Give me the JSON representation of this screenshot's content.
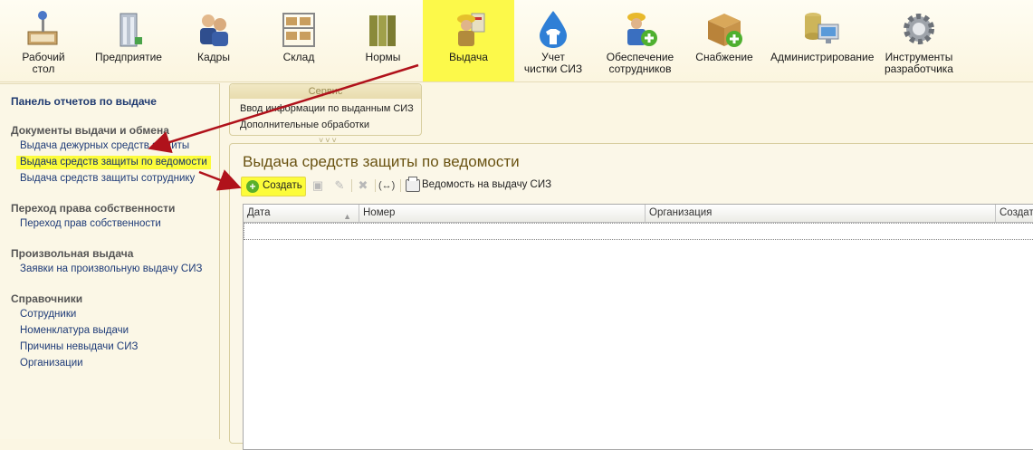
{
  "sections": [
    {
      "label": "Рабочий\nстол",
      "icon": "desk-icon"
    },
    {
      "label": "Предприятие",
      "icon": "building-icon"
    },
    {
      "label": "Кадры",
      "icon": "people-icon"
    },
    {
      "label": "Склад",
      "icon": "warehouse-shelves-icon"
    },
    {
      "label": "Нормы",
      "icon": "binders-icon"
    },
    {
      "label": "Выдача",
      "icon": "worker-issue-icon"
    },
    {
      "label": "Учет\nчистки СИЗ",
      "icon": "water-drop-shirt-icon"
    },
    {
      "label": "Обеспечение\nсотрудников",
      "icon": "worker-add-icon"
    },
    {
      "label": "Снабжение",
      "icon": "box-add-icon"
    },
    {
      "label": "Администрирование",
      "icon": "database-monitor-icon"
    },
    {
      "label": "Инструменты\nразработчика",
      "icon": "gear-icon"
    }
  ],
  "left_panel": {
    "title": "Панель отчетов по выдаче",
    "groups": [
      {
        "title": "Документы выдачи и обмена",
        "items": [
          "Выдача дежурных средств защиты",
          "Выдача средств защиты по ведомости",
          "Выдача средств защиты сотруднику"
        ]
      },
      {
        "title": "Переход права собственности",
        "items": [
          "Переход прав собственности"
        ]
      },
      {
        "title": "Произвольная выдача",
        "items": [
          "Заявки на произвольную выдачу СИЗ"
        ]
      },
      {
        "title": "Справочники",
        "items": [
          "Сотрудники",
          "Номенклатура выдачи",
          "Причины невыдачи СИЗ",
          "Организации"
        ]
      }
    ]
  },
  "service": {
    "title": "Сервис",
    "items": [
      "Ввод информации по выданным СИЗ",
      "Дополнительные обработки"
    ]
  },
  "form": {
    "title": "Выдача средств защиты по ведомости",
    "toolbar": {
      "create_label": "Создать",
      "print_label": "Ведомость на выдачу СИЗ"
    },
    "columns": [
      "Дата",
      "Номер",
      "Организация",
      "Создат"
    ]
  },
  "colors": {
    "highlight": "#fcfc3a",
    "arrow": "#b0121b",
    "link": "#1e3b78",
    "form_title": "#6a5312"
  }
}
